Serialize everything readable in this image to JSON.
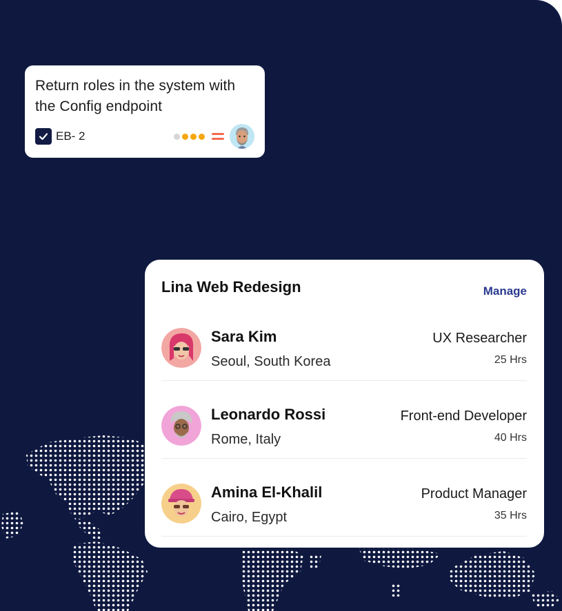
{
  "task_card": {
    "title": "Return roles in the system with the Config endpoint",
    "task_id": "EB- 2",
    "progress_dots": [
      "#d6d6d6",
      "#f4a70e",
      "#f4a70e",
      "#f4a70e"
    ],
    "priority_color": "#f26a4b",
    "checkbox_checked": true
  },
  "team_card": {
    "title": "Lina Web Redesign",
    "manage_label": "Manage",
    "members": [
      {
        "name": "Sara Kim",
        "location": "Seoul, South Korea",
        "role": "UX Researcher",
        "hours": "25 Hrs",
        "avatar_bg": "#f3a7a3"
      },
      {
        "name": "Leonardo Rossi",
        "location": "Rome, Italy",
        "role": "Front-end Developer",
        "hours": "40 Hrs",
        "avatar_bg": "#f1a4d8"
      },
      {
        "name": "Amina El-Khalil",
        "location": "Cairo, Egypt",
        "role": "Product Manager",
        "hours": "35 Hrs",
        "avatar_bg": "#f6d08a"
      }
    ]
  },
  "colors": {
    "background": "#0f1940",
    "accent": "#2b3a8f"
  }
}
